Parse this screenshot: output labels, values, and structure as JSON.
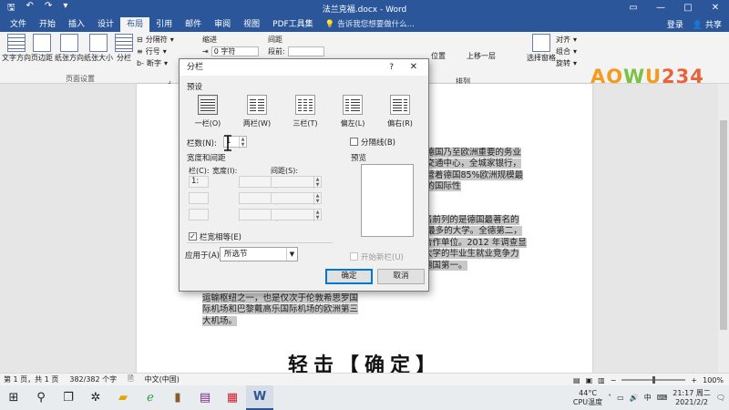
{
  "window": {
    "title": "法兰克福.docx - Word",
    "controls": [
      "—",
      "□",
      "✕"
    ]
  },
  "ribbon_tabs": [
    "文件",
    "开始",
    "插入",
    "设计",
    "布局",
    "引用",
    "邮件",
    "审阅",
    "视图",
    "PDF工具集"
  ],
  "active_tab": "布局",
  "tell_me": "告诉我您想要做什么...",
  "account": {
    "login": "登录",
    "share": "共享"
  },
  "ribbon": {
    "text_direction": "文字方向",
    "margins": "页边距",
    "orientation": "纸张方向",
    "size": "纸张大小",
    "columns": "分栏",
    "breaks": "分隔符",
    "line_numbers": "行号",
    "hyphenation": "断字",
    "page_setup_group": "页面设置",
    "indent_label": "缩进",
    "spacing_label": "间距",
    "indent_left_value": "0 字符",
    "spacing_before_label": "段前:",
    "position": "位置",
    "wrap_text": "环绕文字",
    "bring_forward": "上移一层",
    "send_backward": "下移一层",
    "selection_pane": "选择窗格",
    "align": "对齐",
    "group": "组合",
    "rotate": "旋转",
    "arrange_group": "排列",
    "logo_text": "AOWU234"
  },
  "document": {
    "right_col_1": "是德国乃至欧洲重要的务业和交通中心，全城家银行，经营着德国85%欧洲规模最大的国际性",
    "right_col_2": "大学是德国排名前列的是德国最著名的研究rd 获得者最多的大学。全德第二，马普所在法个合作单位。2012 年调查显示，法兰克福大学的毕业生就业竞争力排世界第十，德国第一。",
    "left_col_tail": "运输枢纽之一，也是仅次于伦敦希思罗国际机场和巴黎戴高乐国际机场的欧洲第三大机场。"
  },
  "subtitle": "轻击【确定】",
  "statusbar": {
    "page": "第 1 页，共 1 页",
    "words": "382/382 个字",
    "lang": "中文(中国)",
    "zoom": "100%"
  },
  "taskbar": {
    "temp": "44°C",
    "temp_label": "CPU温度",
    "time": "21:17 周二",
    "date": "2021/2/2",
    "ime": "中"
  },
  "dialog": {
    "title": "分栏",
    "help": "?",
    "close": "✕",
    "presets_label": "预设",
    "presets": [
      "一栏(O)",
      "两栏(W)",
      "三栏(T)",
      "偏左(L)",
      "偏右(R)"
    ],
    "selected_preset": "一栏(O)",
    "num_columns_label": "栏数(N):",
    "num_columns_value": "1",
    "line_between_label": "分隔线(B)",
    "width_spacing_label": "宽度和间距",
    "col_header": "栏(C):",
    "width_header": "宽度(I):",
    "spacing_header": "间距(S):",
    "row1_col": "1:",
    "equal_width_label": "栏宽相等(E)",
    "preview_label": "预览",
    "apply_to_label": "应用于(A):",
    "apply_to_value": "所选节",
    "new_column_label": "开始新栏(U)",
    "ok": "确定",
    "cancel": "取消"
  }
}
